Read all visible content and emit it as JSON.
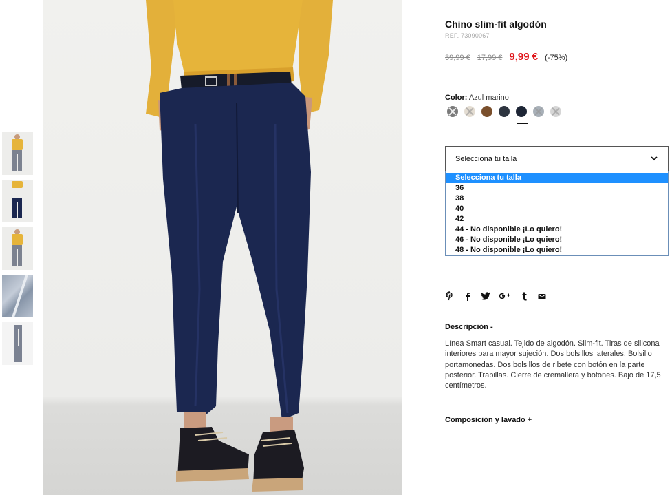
{
  "product": {
    "title": "Chino slim-fit algodón",
    "ref": "REF. 73090067",
    "price_original": "39,99 €",
    "price_previous": "17,99 €",
    "price_current": "9,99 €",
    "discount": "(-75%)"
  },
  "color": {
    "label": "Color:",
    "value": "Azul marino",
    "swatches": [
      {
        "name": "gris",
        "hex": "#7a7a7a",
        "available": false
      },
      {
        "name": "beige",
        "hex": "#e4ddd2",
        "available": false
      },
      {
        "name": "marron",
        "hex": "#7a4f2c",
        "available": true
      },
      {
        "name": "azul-oscuro",
        "hex": "#2e3540",
        "available": true
      },
      {
        "name": "azul-marino",
        "hex": "#1d2535",
        "available": true,
        "selected": true
      },
      {
        "name": "gris-azulado",
        "hex": "#a8b0b8",
        "available": false
      },
      {
        "name": "gris-claro",
        "hex": "#d6d6d6",
        "available": false
      }
    ]
  },
  "size": {
    "placeholder": "Selecciona tu talla",
    "options": [
      "Selecciona tu talla",
      "36",
      "38",
      "40",
      "42",
      "44 - No disponible ¡Lo quiero!",
      "46 - No disponible ¡Lo quiero!",
      "48 - No disponible ¡Lo quiero!"
    ]
  },
  "share": [
    "pinterest-icon",
    "facebook-icon",
    "twitter-icon",
    "google-plus-icon",
    "tumblr-icon",
    "email-icon"
  ],
  "description": {
    "heading": "Descripción  -",
    "text": "Línea Smart casual. Tejido de algodón. Slim-fit. Tiras de silicona interiores para mayor sujeción. Dos bolsillos laterales. Bolsillo portamonedas. Dos bolsillos de ribete con botón en la parte posterior. Trabillas. Cierre de cremallera y botones. Bajo de 17,5 centímetros."
  },
  "composition": {
    "heading": "Composición y lavado  +"
  },
  "colors": {
    "price_red": "#e0161b",
    "dropdown_highlight": "#1e90ff",
    "pants_navy": "#1b2750",
    "sweater_mustard": "#e6b43a"
  }
}
